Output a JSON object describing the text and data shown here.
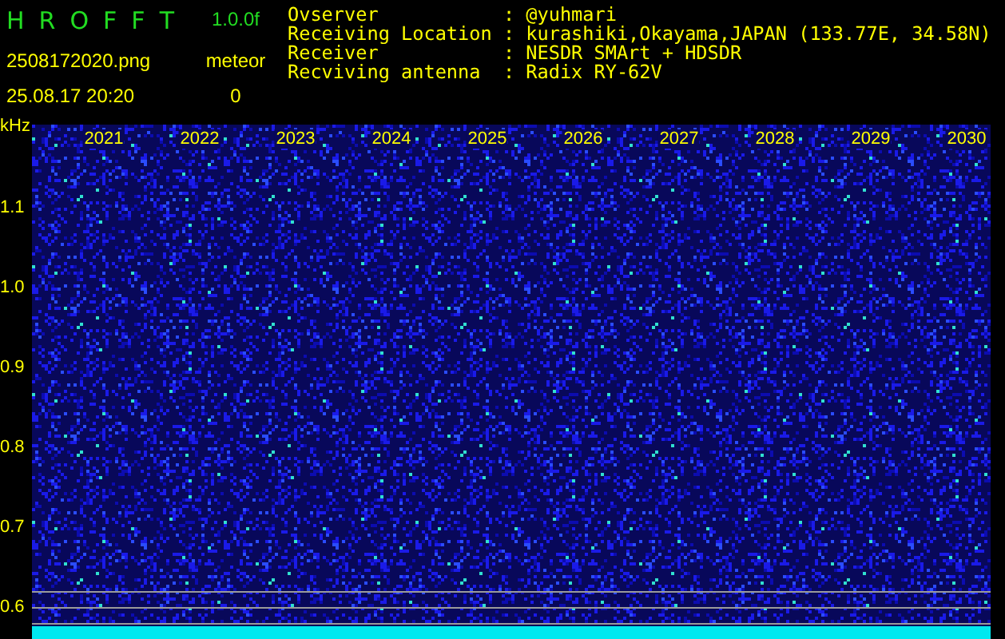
{
  "header": {
    "title_letters": [
      "H",
      "R",
      "O",
      "F",
      "F",
      "T"
    ],
    "version": "1.0.0f",
    "filename": "2508172020.png",
    "timestamp": "25.08.17 20:20",
    "detection_label": "meteor",
    "detection_count": "0"
  },
  "station_info": [
    {
      "label": "Ovserver",
      "separator": ":",
      "value": "@yuhmari"
    },
    {
      "label": "Receiving Location",
      "separator": ":",
      "value": "kurashiki,Okayama,JAPAN (133.77E, 34.58N)"
    },
    {
      "label": "Receiver",
      "separator": ":",
      "value": "NESDR SMArt + HDSDR"
    },
    {
      "label": "Recviving antenna",
      "separator": ":",
      "value": "Radix RY-62V"
    }
  ],
  "spectrogram": {
    "y_unit": "kHz",
    "x_labels": [
      "2021",
      "2022",
      "2023",
      "2024",
      "2025",
      "2026",
      "2027",
      "2028",
      "2029",
      "2030"
    ],
    "y_labels": [
      "1.1",
      "1.0",
      "0.9",
      "0.8",
      "0.7",
      "0.6"
    ]
  }
}
